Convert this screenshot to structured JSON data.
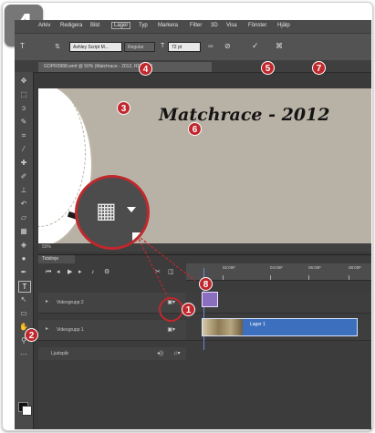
{
  "badge": "4",
  "menubar": [
    "Arkiv",
    "Redigera",
    "Bild",
    "Lager",
    "Typ",
    "Markera",
    "Filter",
    "3D",
    "Visa",
    "Fönster",
    "Hjälp"
  ],
  "options": {
    "font": "Ashley Script M...",
    "style": "Regular",
    "size": "72 pt"
  },
  "document_tab": "GOPR0988.wmf @ 50% (Matchrace - 2012, RGB/8) *",
  "canvas_title": "Matchrace - 2012",
  "status_zoom": "50%",
  "timeline": {
    "tab": "Tidslinje",
    "ruler": [
      "02:00F",
      "04:00F",
      "06:00F",
      "08:00F"
    ],
    "tracks": [
      {
        "label": "Videogrupp 2"
      },
      {
        "label": "Videogrupp 1",
        "clip": "Lager 1"
      }
    ],
    "audio_label": "Ljudspår"
  },
  "markers": [
    "1",
    "2",
    "3",
    "4",
    "5",
    "6",
    "7",
    "8"
  ],
  "colors": {
    "marker_red": "#c0282d",
    "clip_blue": "#3d6fbf",
    "clip_purple": "#8b6fbf"
  },
  "icons": [
    "film-icon",
    "dropdown-caret-icon",
    "play-icon",
    "scissors-icon",
    "text-tool-icon",
    "move-tool-icon"
  ]
}
